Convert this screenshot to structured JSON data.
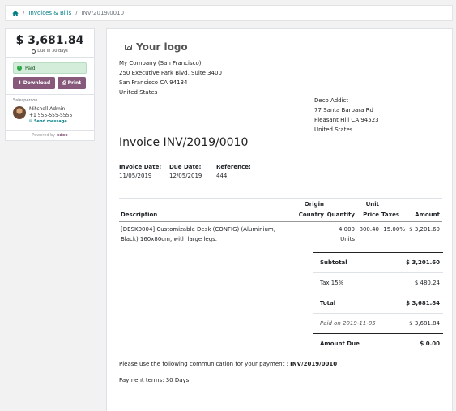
{
  "breadcrumb": {
    "items": [
      "Invoices & Bills",
      "INV/2019/0010"
    ],
    "separator": "/"
  },
  "sidebar": {
    "amount": "$ 3,681.84",
    "due": "Due in 30 days",
    "status": "Paid",
    "download_label": "Download",
    "print_label": "Print",
    "salesperson_label": "Salesperson",
    "person_name": "Mitchell Admin",
    "person_phone": "+1 555-555-5555",
    "send_message": "Send message",
    "powered_by": "Powered by",
    "powered_brand": "odoo"
  },
  "invoice": {
    "logo_text": "Your logo",
    "company_lines": [
      "My Company (San Francisco)",
      "250 Executive Park Blvd, Suite 3400",
      "San Francisco CA 94134",
      "United States"
    ],
    "customer_lines": [
      "Deco Addict",
      "77 Santa Barbara Rd",
      "Pleasant Hill CA 94523",
      "United States"
    ],
    "title": "Invoice INV/2019/0010",
    "info": {
      "invoice_date_label": "Invoice Date:",
      "invoice_date": "11/05/2019",
      "due_date_label": "Due Date:",
      "due_date": "12/05/2019",
      "reference_label": "Reference:",
      "reference": "444"
    },
    "columns": {
      "description": "Description",
      "origin_line1": "Origin",
      "origin_line2": "Country",
      "quantity": "Quantity",
      "unit_line1": "Unit",
      "unit_line2": "Price",
      "taxes": "Taxes",
      "amount": "Amount"
    },
    "line": {
      "description_line1": "[DESK0004] Customizable Desk (CONFIG) (Aluminium,",
      "description_line2": "Black) 160x80cm, with large legs.",
      "quantity_line1": "4.000",
      "quantity_line2": "Units",
      "unit_price": "800.40",
      "taxes": "15.00%",
      "amount": "$ 3,201.60"
    },
    "totals": {
      "subtotal_label": "Subtotal",
      "subtotal": "$ 3,201.60",
      "tax_label": "Tax 15%",
      "tax": "$ 480.24",
      "total_label": "Total",
      "total": "$ 3,681.84",
      "paid_label": "Paid on 2019-11-05",
      "paid": "$ 3,681.84",
      "due_label": "Amount Due",
      "due": "$ 0.00"
    },
    "communication_text": "Please use the following communication for your payment :",
    "communication_ref": "INV/2019/0010",
    "payment_terms": "Payment terms: 30 Days"
  },
  "colors": {
    "accent": "#875a7b",
    "link": "#017e84",
    "paid_bg": "#d4edda"
  }
}
